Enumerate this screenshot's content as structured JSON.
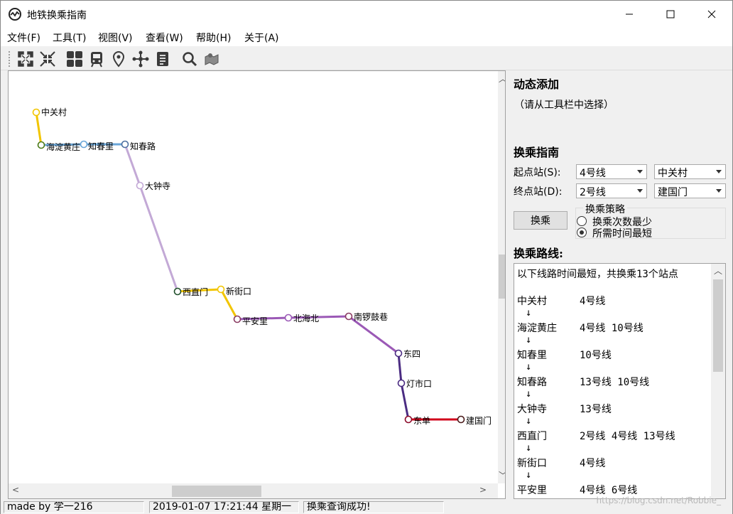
{
  "window": {
    "title": "地铁换乘指南"
  },
  "menu": [
    "文件(F)",
    "工具(T)",
    "视图(V)",
    "查看(W)",
    "帮助(H)",
    "关于(A)"
  ],
  "toolbar_icons": [
    "expand-icon",
    "collapse-icon",
    "grid-icon",
    "train-icon",
    "location-pin-icon",
    "network-icon",
    "document-icon",
    "search-icon",
    "map-icon"
  ],
  "map": {
    "stations": [
      {
        "name": "中关村",
        "color": "#f2c500",
        "ring": "#f2c500"
      },
      {
        "name": "海淀黄庄",
        "color": "#8aa51e",
        "ring": "#4b7a18"
      },
      {
        "name": "知春里",
        "color": "#6aa6d8",
        "ring": "#6aa6d8"
      },
      {
        "name": "知春路",
        "color": "#6aa6d8",
        "ring": "#4d6fa0"
      },
      {
        "name": "大钟寺",
        "color": "#c3a9d6",
        "ring": "#c3a9d6"
      },
      {
        "name": "西直门",
        "color": "#8aa51e",
        "ring": "#1f4f2b"
      },
      {
        "name": "新街口",
        "color": "#f2c500",
        "ring": "#f2c500"
      },
      {
        "name": "平安里",
        "color": "#c65a2a",
        "ring": "#8a3b62"
      },
      {
        "name": "北海北",
        "color": "#9b59b6",
        "ring": "#9b59b6"
      },
      {
        "name": "南锣鼓巷",
        "color": "#c0392b",
        "ring": "#8a3b62"
      },
      {
        "name": "东四",
        "color": "#4b2c82",
        "ring": "#4b2c82"
      },
      {
        "name": "灯市口",
        "color": "#4b2c82",
        "ring": "#4b2c82"
      },
      {
        "name": "东单",
        "color": "#d0021b",
        "ring": "#8b0a2a"
      },
      {
        "name": "建国门",
        "color": "#d0021b",
        "ring": "#4a1a1a"
      }
    ],
    "segment_colors": [
      "#f2c500",
      "#6aa6d8",
      "#6aa6d8",
      "#c3a9d6",
      "#c3a9d6",
      "#f2c500",
      "#f2c500",
      "#9b59b6",
      "#9b59b6",
      "#9b59b6",
      "#4b2c82",
      "#4b2c82",
      "#d0021b"
    ]
  },
  "panel": {
    "dynamic_add_title": "动态添加",
    "dynamic_add_hint": "（请从工具栏中选择）",
    "guide_title": "换乘指南",
    "start_label": "起点站(S):",
    "start_line": "4号线",
    "start_station": "中关村",
    "end_label": "终点站(D):",
    "end_line": "2号线",
    "end_station": "建国门",
    "transfer_button": "换乘",
    "strategy_title": "换乘策略",
    "strategy_options": [
      "换乘次数最少",
      "所需时间最短"
    ],
    "strategy_selected": 1,
    "route_title": "换乘路线:",
    "route_summary": "以下线路时间最短，共换乘13个站点",
    "route": [
      {
        "station": "中关村",
        "lines": "4号线"
      },
      {
        "station": "海淀黄庄",
        "lines": "4号线 10号线"
      },
      {
        "station": "知春里",
        "lines": "10号线"
      },
      {
        "station": "知春路",
        "lines": "13号线 10号线"
      },
      {
        "station": "大钟寺",
        "lines": "13号线"
      },
      {
        "station": "西直门",
        "lines": "2号线 4号线 13号线"
      },
      {
        "station": "新街口",
        "lines": "4号线"
      },
      {
        "station": "平安里",
        "lines": "4号线 6号线"
      }
    ],
    "arrow": "↓"
  },
  "status": {
    "author": "made by 学一216",
    "datetime": "2019-01-07 17:21:44 星期一",
    "message": "换乘查询成功!"
  },
  "watermark": "https://blog.csdn.net/Robbie_"
}
